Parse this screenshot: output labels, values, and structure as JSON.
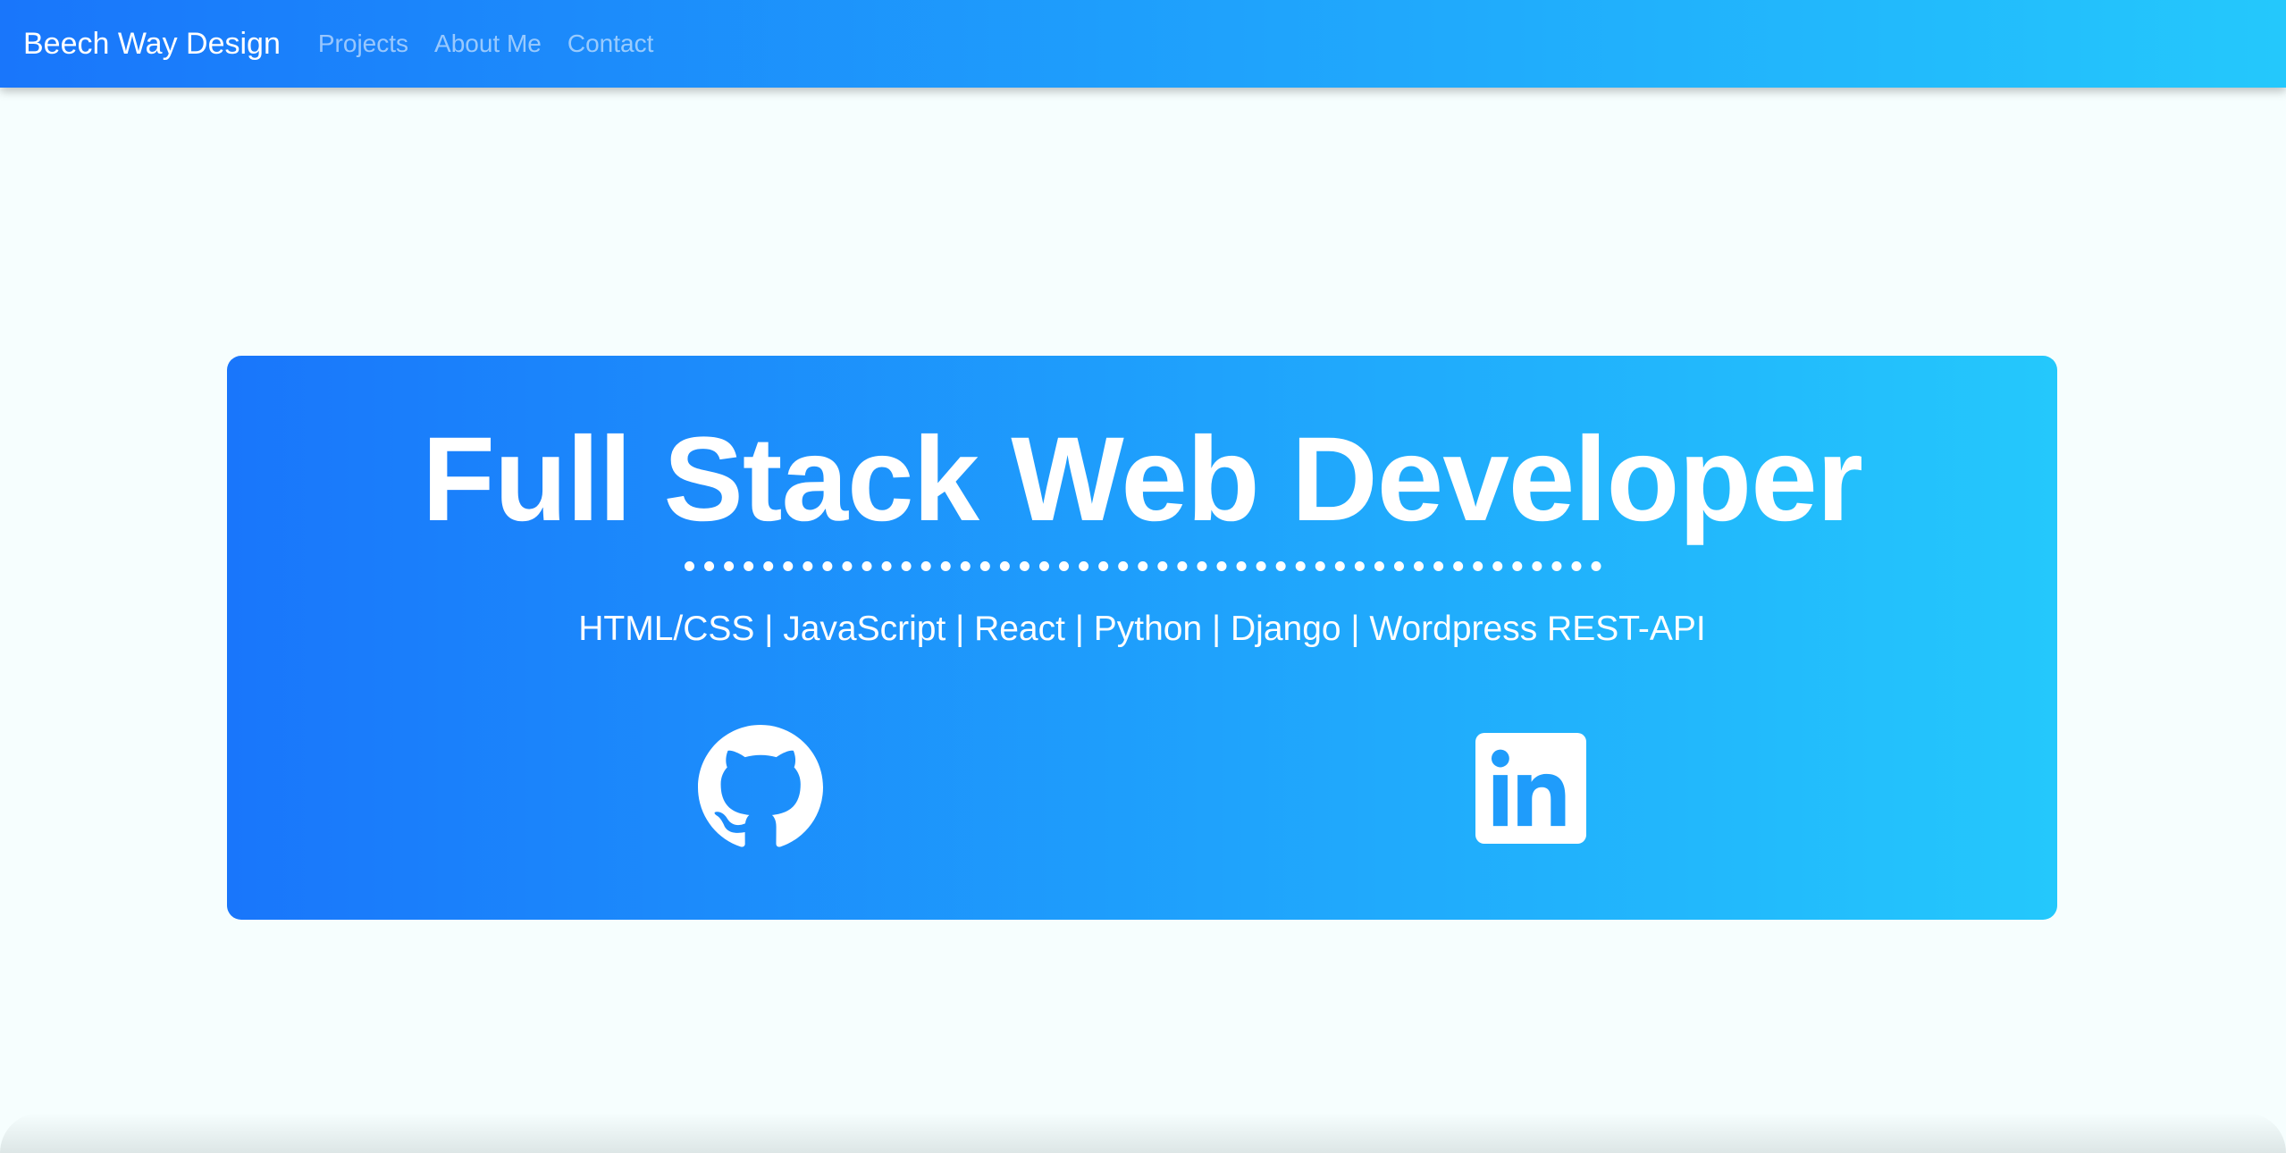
{
  "navbar": {
    "brand": "Beech Way Design",
    "links": [
      "Projects",
      "About Me",
      "Contact"
    ]
  },
  "hero": {
    "title": "Full Stack Web Developer",
    "skills": "HTML/CSS | JavaScript | React | Python | Django | Wordpress REST-API",
    "social": [
      {
        "name": "github",
        "icon": "github-icon"
      },
      {
        "name": "linkedin",
        "icon": "linkedin-icon"
      }
    ]
  },
  "colors": {
    "gradient_start": "#1976fb",
    "gradient_end": "#24c8fc",
    "page_background": "#f6fefe",
    "text": "#ffffff"
  }
}
